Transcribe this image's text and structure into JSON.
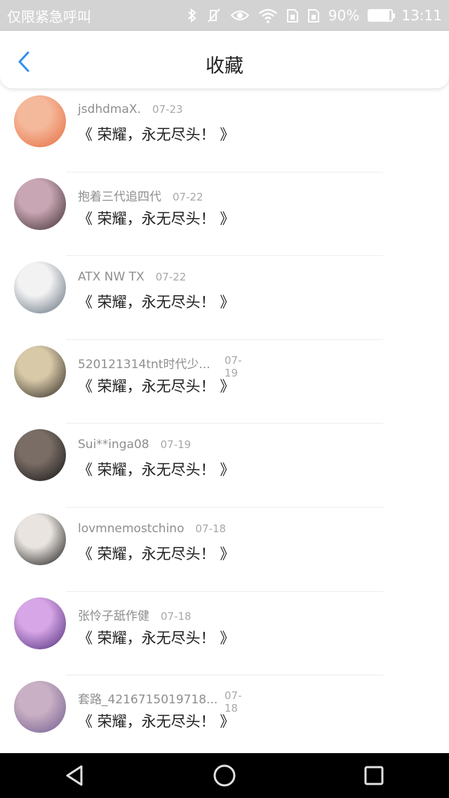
{
  "status_bar": {
    "carrier": "仅限紧急呼叫",
    "battery": "90%",
    "battery_level": 0.9,
    "time": "13:11",
    "icons": [
      "bluetooth-icon",
      "vibrate-off-icon",
      "eye-icon",
      "wifi-icon",
      "sim-icon",
      "sim2-icon",
      "battery-icon"
    ]
  },
  "header": {
    "title": "收藏",
    "back_icon": "chevron-left-icon",
    "accent": "#2f8ff2"
  },
  "items": [
    {
      "user": "jsdhdmaX.",
      "date": "07-23",
      "text": "《 荣耀，永无尽头！ 》",
      "avatar_colors": [
        "#f4b89a",
        "#e66a3c"
      ]
    },
    {
      "user": "抱着三代追四代",
      "date": "07-22",
      "text": "《 荣耀，永无尽头！ 》",
      "avatar_colors": [
        "#c9a6b4",
        "#3a2c2e"
      ]
    },
    {
      "user": "ATX NW TX",
      "date": "07-22",
      "text": "《 荣耀，永无尽头！ 》",
      "avatar_colors": [
        "#f2f2f2",
        "#5c6a78"
      ]
    },
    {
      "user": "520121314tnt时代少...",
      "date": "07-19",
      "text": "《 荣耀，永无尽头！ 》",
      "avatar_colors": [
        "#d8c9a8",
        "#2b2520"
      ]
    },
    {
      "user": "Sui**inga08",
      "date": "07-19",
      "text": "《 荣耀，永无尽头！ 》",
      "avatar_colors": [
        "#7a6d66",
        "#121212"
      ]
    },
    {
      "user": "lovmnemostchino",
      "date": "07-18",
      "text": "《 荣耀，永无尽头！ 》",
      "avatar_colors": [
        "#e9e4df",
        "#111111"
      ]
    },
    {
      "user": "张怜子舐作健",
      "date": "07-18",
      "text": "《 荣耀，永无尽头！ 》",
      "avatar_colors": [
        "#d7a6e6",
        "#4a2a78"
      ]
    },
    {
      "user": "套路_4216715019718...",
      "date": "07-18",
      "text": "《 荣耀，永无尽头！ 》",
      "avatar_colors": [
        "#c9b0c4",
        "#6e5a8e"
      ]
    }
  ],
  "nav_buttons": [
    "back-triangle-icon",
    "home-circle-icon",
    "recents-square-icon"
  ]
}
